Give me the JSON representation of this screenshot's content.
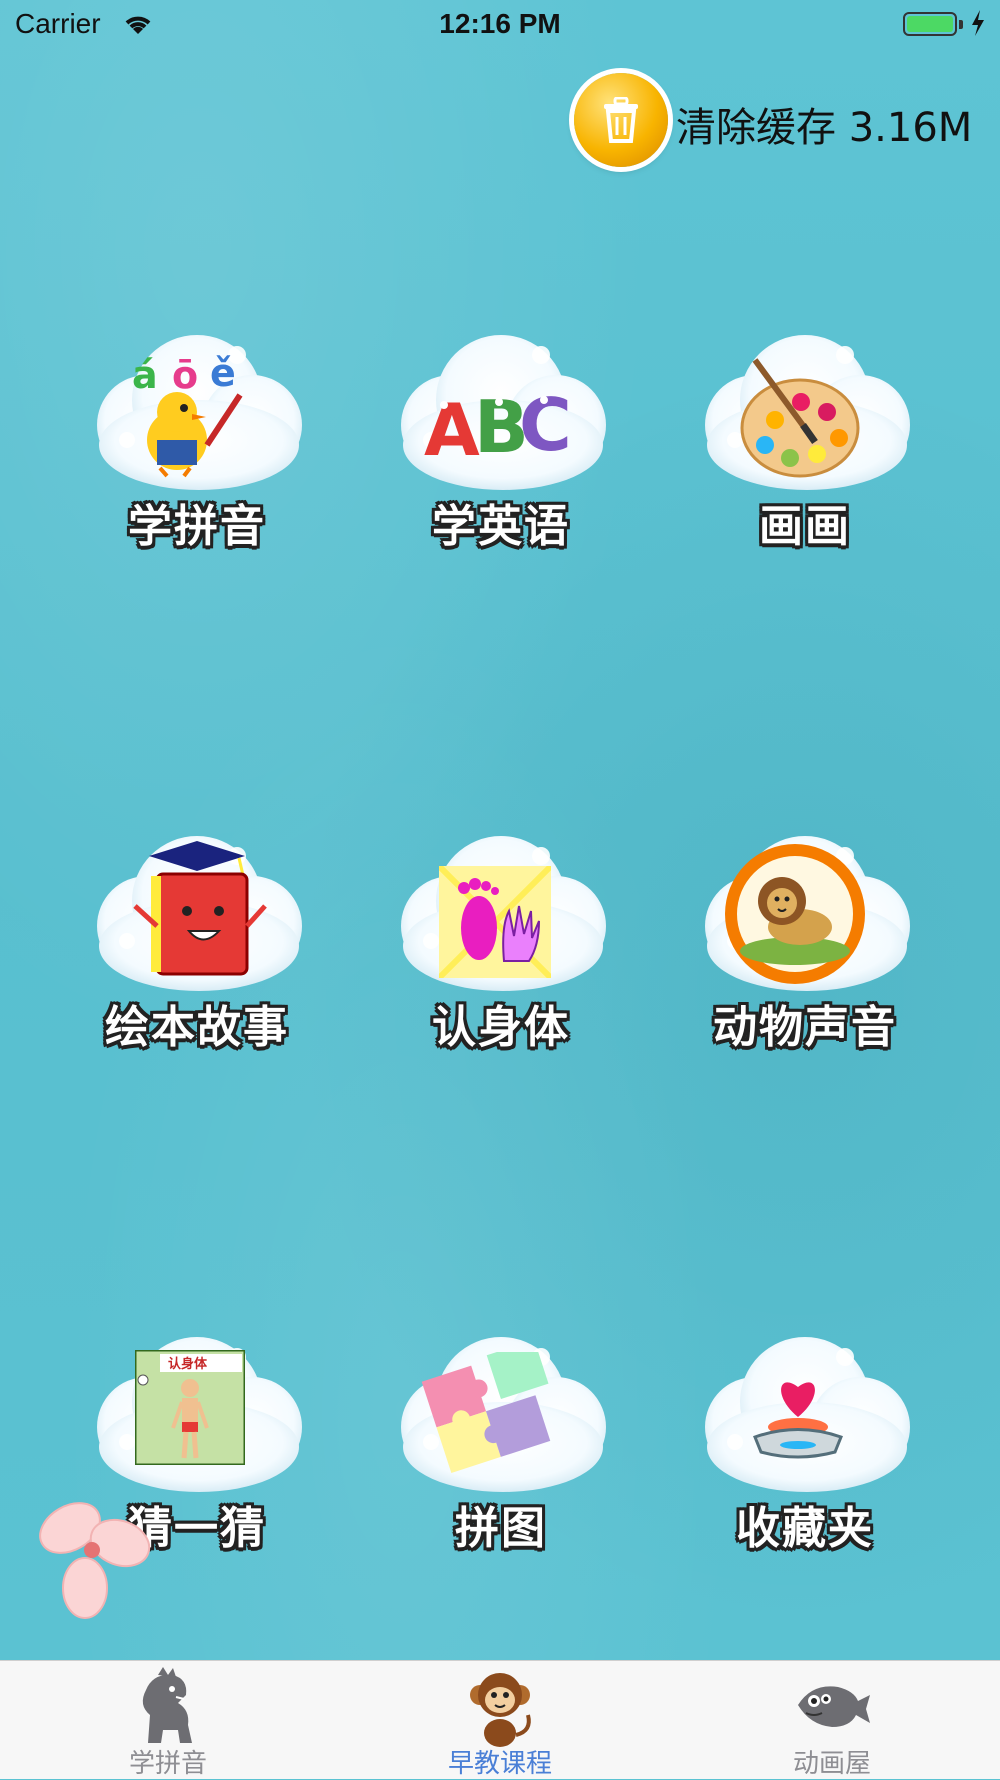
{
  "status_bar": {
    "carrier": "Carrier",
    "time": "12:16 PM"
  },
  "clear_cache": {
    "label": "清除缓存 3.16M",
    "icon": "trash-icon"
  },
  "tiles": [
    {
      "label": "学拼音",
      "icon": "pinyin-bird-icon"
    },
    {
      "label": "学英语",
      "icon": "abc-letters-icon"
    },
    {
      "label": "画画",
      "icon": "paint-palette-icon"
    },
    {
      "label": "绘本故事",
      "icon": "storybook-icon"
    },
    {
      "label": "认身体",
      "icon": "hand-foot-icon"
    },
    {
      "label": "动物声音",
      "icon": "lion-icon"
    },
    {
      "label": "猜一猜",
      "icon": "body-chart-icon"
    },
    {
      "label": "拼图",
      "icon": "puzzle-icon"
    },
    {
      "label": "收藏夹",
      "icon": "heart-pedestal-icon"
    }
  ],
  "tabs": [
    {
      "label": "学拼音",
      "icon": "dinosaur-icon",
      "active": false
    },
    {
      "label": "早教课程",
      "icon": "monkey-icon",
      "active": true
    },
    {
      "label": "动画屋",
      "icon": "fish-icon",
      "active": false
    }
  ],
  "colors": {
    "background": "#5cc3d2",
    "active_tab": "#4a7fd6",
    "inactive_tab": "#8e8e93"
  }
}
